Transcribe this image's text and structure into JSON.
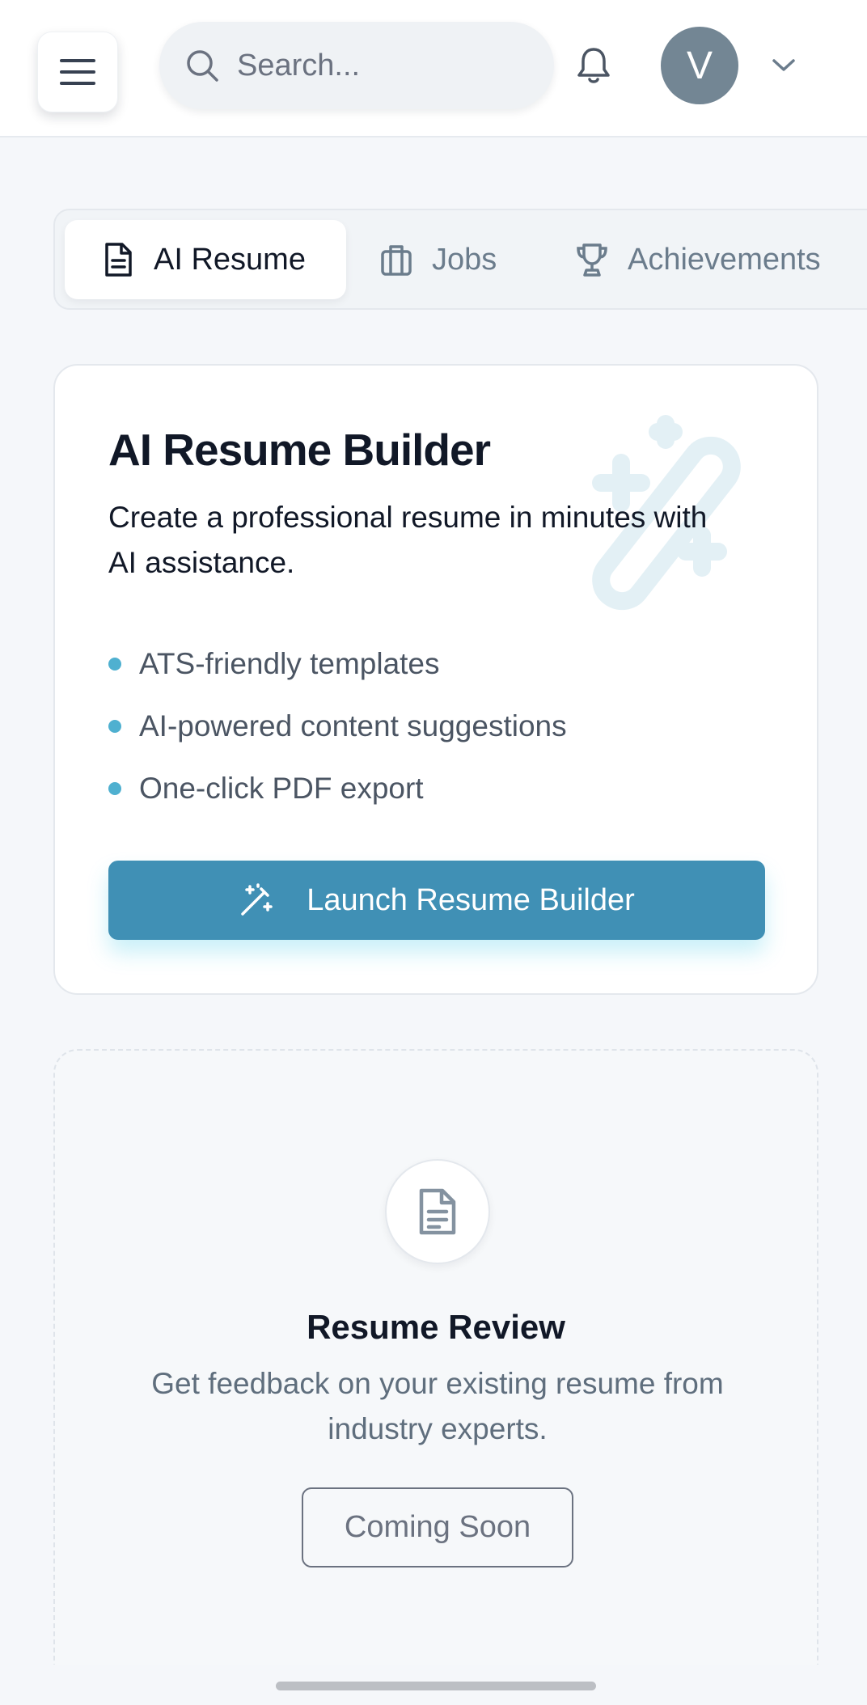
{
  "header": {
    "search_placeholder": "Search...",
    "avatar_initial": "V"
  },
  "tabs": [
    {
      "label": "AI Resume",
      "icon": "document-icon",
      "active": true
    },
    {
      "label": "Jobs",
      "icon": "briefcase-icon",
      "active": false
    },
    {
      "label": "Achievements",
      "icon": "trophy-icon",
      "active": false
    }
  ],
  "builder": {
    "title": "AI Resume Builder",
    "description": "Create a professional resume in minutes with AI assistance.",
    "features": [
      "ATS-friendly templates",
      "AI-powered content suggestions",
      "One-click PDF export"
    ],
    "button_label": "Launch Resume Builder"
  },
  "review": {
    "title": "Resume Review",
    "description": "Get feedback on your existing resume from industry experts.",
    "button_label": "Coming Soon"
  },
  "colors": {
    "accent": "#4090b5",
    "bullet": "#4fb0d0",
    "avatar": "#738694"
  }
}
